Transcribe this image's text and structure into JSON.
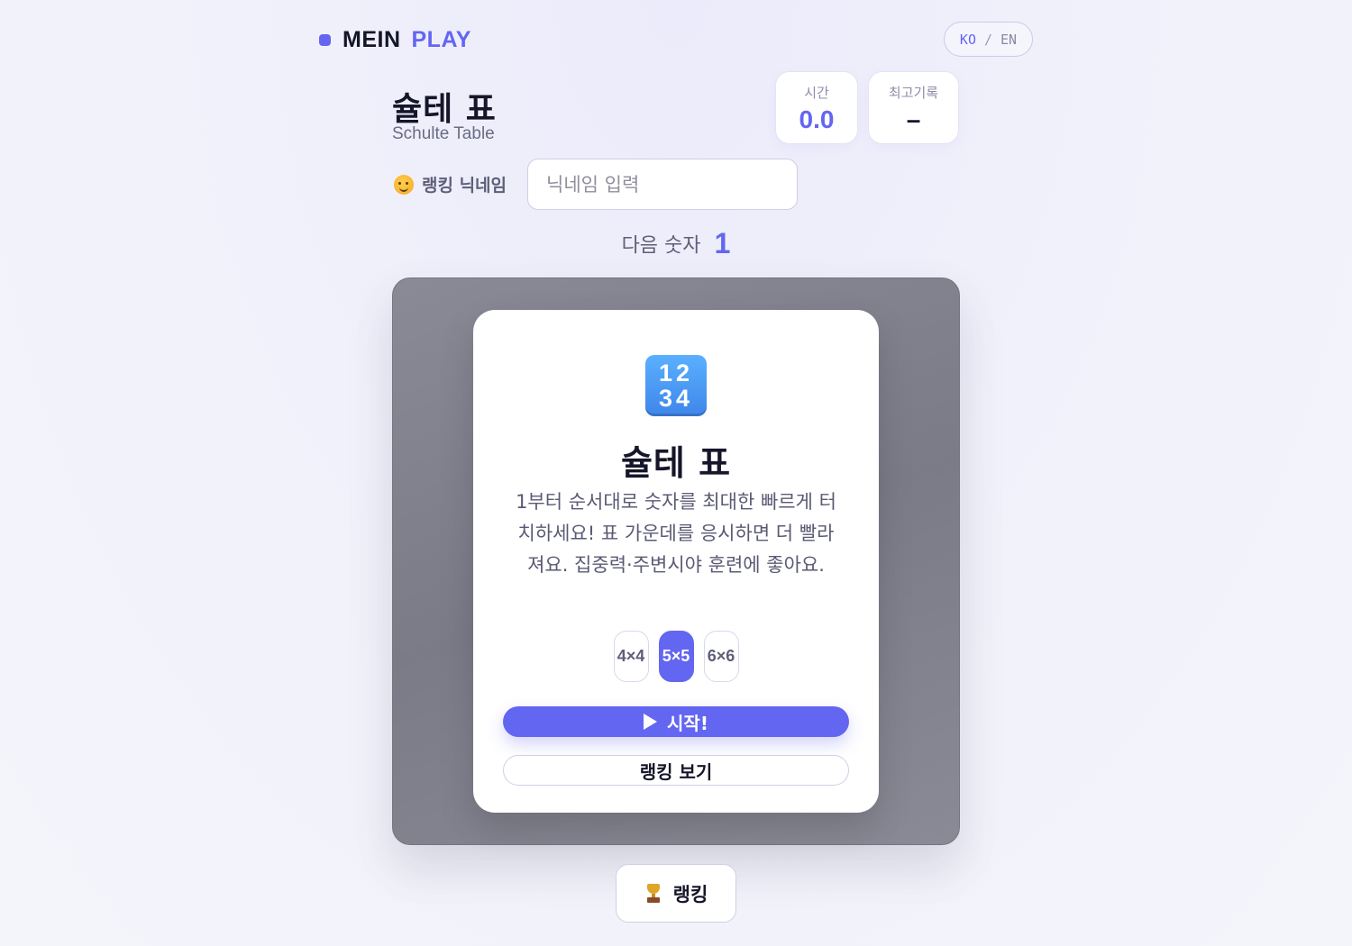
{
  "header": {
    "logo_part1": "MEIN",
    "logo_part2": "PLAY",
    "lang_ko": "KO",
    "lang_sep": "/",
    "lang_en": "EN"
  },
  "game": {
    "title": "슐테 표",
    "subtitle": "Schulte Table"
  },
  "stats": {
    "time_label": "시간",
    "time_value": "0.0",
    "best_label": "최고기록",
    "best_value": "–"
  },
  "nickname": {
    "label": "랭킹 닉네임",
    "placeholder": "닉네임 입력",
    "value": ""
  },
  "next": {
    "label": "다음 숫자",
    "number": "1"
  },
  "modal": {
    "icon_top": "12",
    "icon_bottom": "34",
    "title": "슐테 표",
    "description": "1부터 순서대로 숫자를 최대한 빠르게 터치하세요! 표 가운데를 응시하면 더 빨라져요. 집중력·주변시야 훈련에 좋아요.",
    "sizes": [
      {
        "label": "4×4",
        "active": false
      },
      {
        "label": "5×5",
        "active": true
      },
      {
        "label": "6×6",
        "active": false
      }
    ],
    "start_label": "시작!",
    "ranking_view_label": "랭킹 보기"
  },
  "footer": {
    "ranking_label": "랭킹"
  },
  "colors": {
    "accent": "#6366f1",
    "text_dark": "#16162a",
    "text_muted": "#5e5e7a",
    "board": "#83838f"
  },
  "icons": {
    "logo": "square-dot-icon",
    "nickname": "smiling-face-icon",
    "modal": "input-numbers-keycap-icon",
    "start": "play-triangle-icon",
    "ranking": "trophy-icon"
  }
}
